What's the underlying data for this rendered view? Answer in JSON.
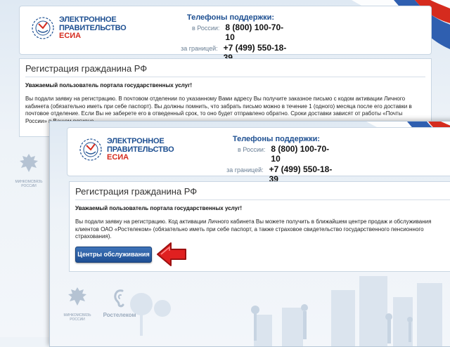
{
  "logo": {
    "line1": "ЭЛЕКТРОННОЕ",
    "line2": "ПРАВИТЕЛЬСТВО",
    "line3": "ЕСИА"
  },
  "support": {
    "title": "Телефоны поддержки:",
    "russia_label": "в России:",
    "russia_phone": "8 (800) 100-70-10",
    "abroad_label": "за границей:",
    "abroad_phone": "+7 (499) 550-18-39"
  },
  "back_page": {
    "title": "Регистрация гражданина РФ",
    "greeting": "Уважаемый пользователь портала государственных услуг!",
    "body": "Вы подали заявку на регистрацию. В почтовом отделении по указанному Вами адресу Вы получите заказное письмо с кодом активации Личного кабинета (обязательно иметь при себе паспорт). Вы должны помнить, что забрать письмо можно в течение 1 (одного) месяца после его доставки в почтовое отделение. Если Вы не заберете его в отведенный срок, то оно будет отправлено обратно. Сроки доставки зависят от работы «Почты России» в Вашем регионе."
  },
  "front_page": {
    "title": "Регистрация гражданина РФ",
    "greeting": "Уважаемый пользователь портала государственных услуг!",
    "body": "Вы подали заявку на регистрацию. Код активации Личного кабинета Вы можете получить в ближайшем центре продаж и обслуживания клиентов ОАО «Ростелеком» (обязательно иметь при себе паспорт, а также страховое свидетельство государственного пенсионного страхования).",
    "button_label": "Центры обслуживания"
  },
  "footer": {
    "ministry_caption": "МИНКОМСВЯЗЬ РОССИИ",
    "rostelecom_caption": "Ростелеком"
  },
  "colors": {
    "brand_blue": "#1d4f91",
    "brand_red": "#d52b1e",
    "arrow_red": "#e02020",
    "button_blue": "#2a5ea5"
  }
}
